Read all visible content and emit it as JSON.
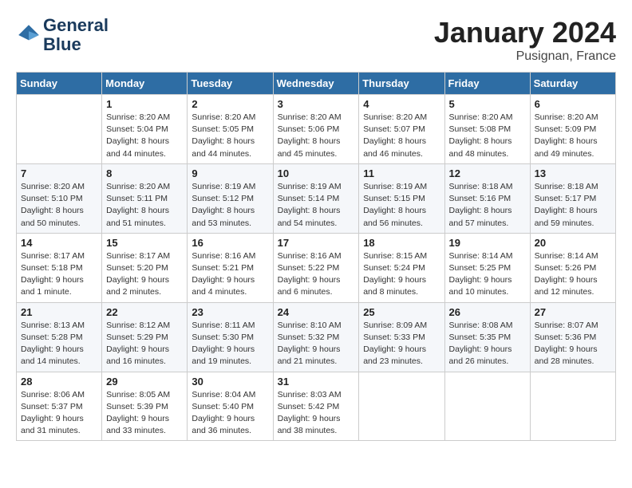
{
  "header": {
    "logo_line1": "General",
    "logo_line2": "Blue",
    "month": "January 2024",
    "location": "Pusignan, France"
  },
  "days_of_week": [
    "Sunday",
    "Monday",
    "Tuesday",
    "Wednesday",
    "Thursday",
    "Friday",
    "Saturday"
  ],
  "weeks": [
    [
      {
        "day": "",
        "info": ""
      },
      {
        "day": "1",
        "info": "Sunrise: 8:20 AM\nSunset: 5:04 PM\nDaylight: 8 hours\nand 44 minutes."
      },
      {
        "day": "2",
        "info": "Sunrise: 8:20 AM\nSunset: 5:05 PM\nDaylight: 8 hours\nand 44 minutes."
      },
      {
        "day": "3",
        "info": "Sunrise: 8:20 AM\nSunset: 5:06 PM\nDaylight: 8 hours\nand 45 minutes."
      },
      {
        "day": "4",
        "info": "Sunrise: 8:20 AM\nSunset: 5:07 PM\nDaylight: 8 hours\nand 46 minutes."
      },
      {
        "day": "5",
        "info": "Sunrise: 8:20 AM\nSunset: 5:08 PM\nDaylight: 8 hours\nand 48 minutes."
      },
      {
        "day": "6",
        "info": "Sunrise: 8:20 AM\nSunset: 5:09 PM\nDaylight: 8 hours\nand 49 minutes."
      }
    ],
    [
      {
        "day": "7",
        "info": "Sunrise: 8:20 AM\nSunset: 5:10 PM\nDaylight: 8 hours\nand 50 minutes."
      },
      {
        "day": "8",
        "info": "Sunrise: 8:20 AM\nSunset: 5:11 PM\nDaylight: 8 hours\nand 51 minutes."
      },
      {
        "day": "9",
        "info": "Sunrise: 8:19 AM\nSunset: 5:12 PM\nDaylight: 8 hours\nand 53 minutes."
      },
      {
        "day": "10",
        "info": "Sunrise: 8:19 AM\nSunset: 5:14 PM\nDaylight: 8 hours\nand 54 minutes."
      },
      {
        "day": "11",
        "info": "Sunrise: 8:19 AM\nSunset: 5:15 PM\nDaylight: 8 hours\nand 56 minutes."
      },
      {
        "day": "12",
        "info": "Sunrise: 8:18 AM\nSunset: 5:16 PM\nDaylight: 8 hours\nand 57 minutes."
      },
      {
        "day": "13",
        "info": "Sunrise: 8:18 AM\nSunset: 5:17 PM\nDaylight: 8 hours\nand 59 minutes."
      }
    ],
    [
      {
        "day": "14",
        "info": "Sunrise: 8:17 AM\nSunset: 5:18 PM\nDaylight: 9 hours\nand 1 minute."
      },
      {
        "day": "15",
        "info": "Sunrise: 8:17 AM\nSunset: 5:20 PM\nDaylight: 9 hours\nand 2 minutes."
      },
      {
        "day": "16",
        "info": "Sunrise: 8:16 AM\nSunset: 5:21 PM\nDaylight: 9 hours\nand 4 minutes."
      },
      {
        "day": "17",
        "info": "Sunrise: 8:16 AM\nSunset: 5:22 PM\nDaylight: 9 hours\nand 6 minutes."
      },
      {
        "day": "18",
        "info": "Sunrise: 8:15 AM\nSunset: 5:24 PM\nDaylight: 9 hours\nand 8 minutes."
      },
      {
        "day": "19",
        "info": "Sunrise: 8:14 AM\nSunset: 5:25 PM\nDaylight: 9 hours\nand 10 minutes."
      },
      {
        "day": "20",
        "info": "Sunrise: 8:14 AM\nSunset: 5:26 PM\nDaylight: 9 hours\nand 12 minutes."
      }
    ],
    [
      {
        "day": "21",
        "info": "Sunrise: 8:13 AM\nSunset: 5:28 PM\nDaylight: 9 hours\nand 14 minutes."
      },
      {
        "day": "22",
        "info": "Sunrise: 8:12 AM\nSunset: 5:29 PM\nDaylight: 9 hours\nand 16 minutes."
      },
      {
        "day": "23",
        "info": "Sunrise: 8:11 AM\nSunset: 5:30 PM\nDaylight: 9 hours\nand 19 minutes."
      },
      {
        "day": "24",
        "info": "Sunrise: 8:10 AM\nSunset: 5:32 PM\nDaylight: 9 hours\nand 21 minutes."
      },
      {
        "day": "25",
        "info": "Sunrise: 8:09 AM\nSunset: 5:33 PM\nDaylight: 9 hours\nand 23 minutes."
      },
      {
        "day": "26",
        "info": "Sunrise: 8:08 AM\nSunset: 5:35 PM\nDaylight: 9 hours\nand 26 minutes."
      },
      {
        "day": "27",
        "info": "Sunrise: 8:07 AM\nSunset: 5:36 PM\nDaylight: 9 hours\nand 28 minutes."
      }
    ],
    [
      {
        "day": "28",
        "info": "Sunrise: 8:06 AM\nSunset: 5:37 PM\nDaylight: 9 hours\nand 31 minutes."
      },
      {
        "day": "29",
        "info": "Sunrise: 8:05 AM\nSunset: 5:39 PM\nDaylight: 9 hours\nand 33 minutes."
      },
      {
        "day": "30",
        "info": "Sunrise: 8:04 AM\nSunset: 5:40 PM\nDaylight: 9 hours\nand 36 minutes."
      },
      {
        "day": "31",
        "info": "Sunrise: 8:03 AM\nSunset: 5:42 PM\nDaylight: 9 hours\nand 38 minutes."
      },
      {
        "day": "",
        "info": ""
      },
      {
        "day": "",
        "info": ""
      },
      {
        "day": "",
        "info": ""
      }
    ]
  ]
}
